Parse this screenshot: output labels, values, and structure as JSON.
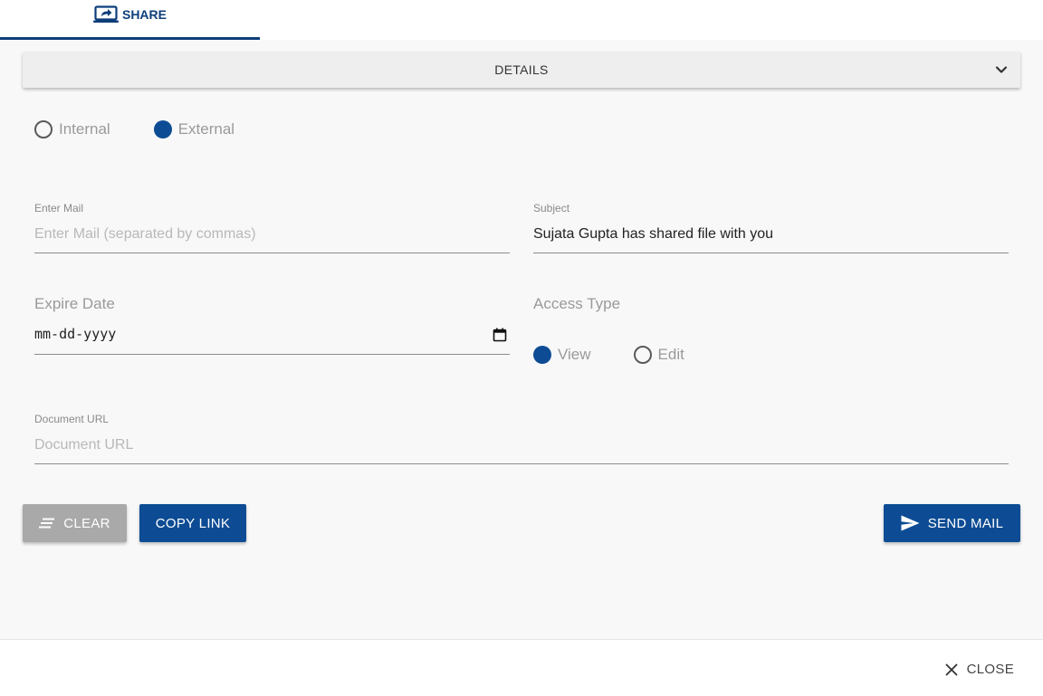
{
  "tabs": [
    {
      "label": "SHARE",
      "icon": "share-screen-icon",
      "active": true
    }
  ],
  "details": {
    "label": "DETAILS",
    "icon": "chevron-down-icon"
  },
  "share_scope": {
    "options": [
      {
        "label": "Internal",
        "checked": false
      },
      {
        "label": "External",
        "checked": true
      }
    ]
  },
  "form": {
    "mail": {
      "label": "Enter Mail",
      "placeholder": "Enter Mail (separated by commas)",
      "value": ""
    },
    "subject": {
      "label": "Subject",
      "value": "Sujata Gupta has shared file with you"
    },
    "expire_date": {
      "label": "Expire Date",
      "value": "mm-dd-yyyy",
      "icon": "calendar-icon"
    },
    "access_type": {
      "label": "Access Type",
      "options": [
        {
          "label": "View",
          "checked": true
        },
        {
          "label": "Edit",
          "checked": false
        }
      ]
    },
    "document_url": {
      "label": "Document URL",
      "placeholder": "Document URL",
      "value": ""
    }
  },
  "actions": {
    "clear": {
      "label": "CLEAR",
      "icon": "clear-lines-icon"
    },
    "copy_link": {
      "label": "COPY LINK"
    },
    "send_mail": {
      "label": "SEND MAIL",
      "icon": "send-icon"
    }
  },
  "footer": {
    "close": {
      "label": "CLOSE",
      "icon": "close-icon"
    }
  },
  "colors": {
    "primary": "#0d4c94",
    "tab_accent": "#0d3e7a",
    "disabled": "#a9a9a9"
  }
}
